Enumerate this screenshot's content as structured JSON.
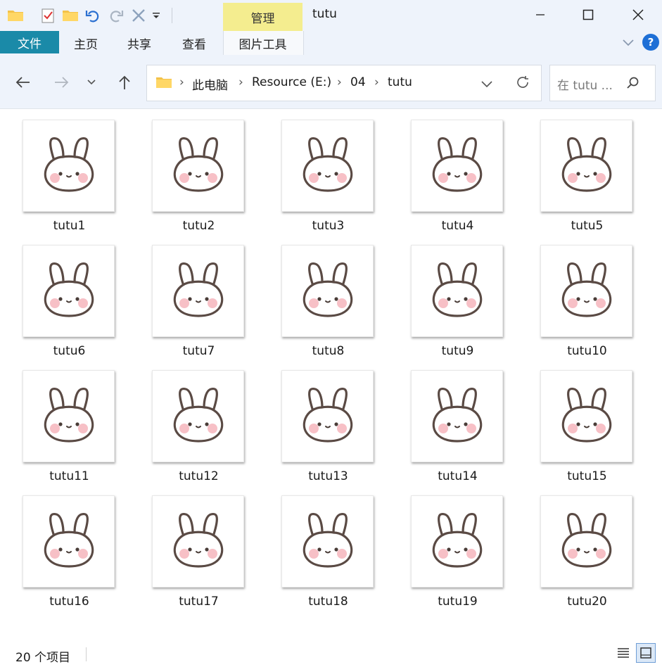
{
  "window": {
    "title": "tutu",
    "context_tab": "管理"
  },
  "quick_access": {
    "icons": [
      "folder-icon",
      "properties-icon",
      "new-folder-icon",
      "undo-icon",
      "redo-icon",
      "delete-icon",
      "customize-dropdown-icon"
    ]
  },
  "ribbon": {
    "tabs": [
      "文件",
      "主页",
      "共享",
      "查看",
      "图片工具"
    ]
  },
  "address": {
    "crumbs": [
      "此电脑",
      "Resource (E:)",
      "04",
      "tutu"
    ]
  },
  "search": {
    "placeholder": "在 tutu ..."
  },
  "files": [
    {
      "name": "tutu1"
    },
    {
      "name": "tutu2"
    },
    {
      "name": "tutu3"
    },
    {
      "name": "tutu4"
    },
    {
      "name": "tutu5"
    },
    {
      "name": "tutu6"
    },
    {
      "name": "tutu7"
    },
    {
      "name": "tutu8"
    },
    {
      "name": "tutu9"
    },
    {
      "name": "tutu10"
    },
    {
      "name": "tutu11"
    },
    {
      "name": "tutu12"
    },
    {
      "name": "tutu13"
    },
    {
      "name": "tutu14"
    },
    {
      "name": "tutu15"
    },
    {
      "name": "tutu16"
    },
    {
      "name": "tutu17"
    },
    {
      "name": "tutu18"
    },
    {
      "name": "tutu19"
    },
    {
      "name": "tutu20"
    }
  ],
  "status": {
    "count_text": "20 个项目"
  },
  "colors": {
    "accent": "#1a8aa8",
    "context_tab": "#f4ed8f",
    "help": "#1e6fd6"
  }
}
